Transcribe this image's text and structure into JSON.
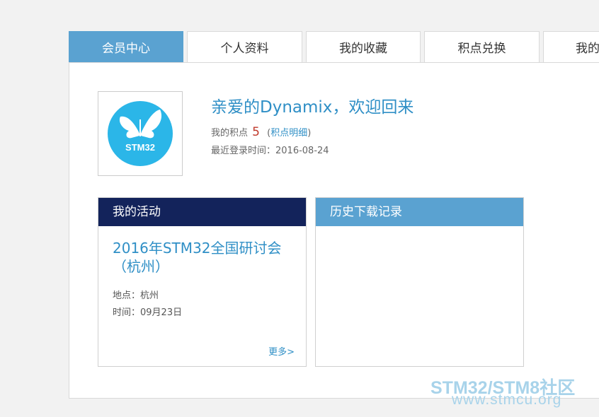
{
  "tabs": [
    {
      "label": "会员中心",
      "active": true
    },
    {
      "label": "个人资料",
      "active": false
    },
    {
      "label": "我的收藏",
      "active": false
    },
    {
      "label": "积点兑换",
      "active": false
    },
    {
      "label": "我的",
      "active": false
    }
  ],
  "profile": {
    "avatar_text": "STM32",
    "welcome": "亲爱的Dynamix，欢迎回来",
    "points_label": "我的积点",
    "points_value": "5",
    "points_open": "(",
    "points_link": "积点明细",
    "points_close": ")",
    "last_login": "最近登录时间：2016-08-24"
  },
  "activities": {
    "header": "我的活动",
    "event_title": "2016年STM32全国研讨会（杭州）",
    "location": "地点：杭州",
    "time": "时间：09月23日",
    "more": "更多>"
  },
  "downloads": {
    "header": "历史下载记录"
  },
  "watermark": {
    "line1": "STM32/STM8社区",
    "line2": "www.stmcu.org"
  },
  "colors": {
    "accent": "#5aa2d1",
    "dark_header": "#13235b",
    "link": "#2f8fc6",
    "points": "#c0392b",
    "avatar": "#2bb6e8"
  }
}
